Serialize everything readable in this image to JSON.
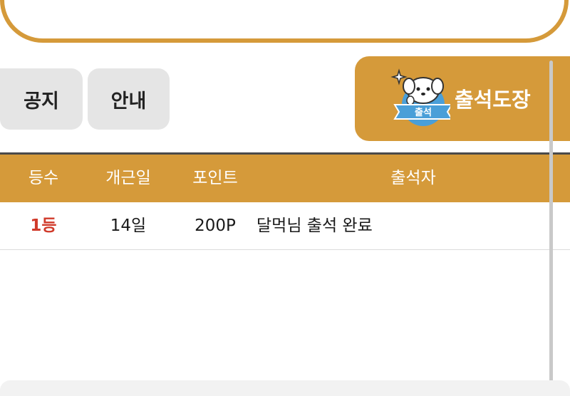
{
  "tabs": {
    "notice_label": "공지",
    "guide_label": "안내"
  },
  "attendance": {
    "button_label": "출석도장",
    "badge_text": "출석"
  },
  "table": {
    "headers": [
      "등수",
      "개근일",
      "포인트",
      "출석자"
    ],
    "rows": [
      {
        "rank": "1등",
        "days": "14일",
        "points": "200P",
        "message": "달먹님 출석 완료"
      }
    ]
  },
  "colors": {
    "accent": "#d59a3a",
    "rank_highlight": "#d03a2a",
    "badge_blue": "#4a9fd8"
  },
  "icons": {
    "mascot": "dog-mascot-icon",
    "sparkle": "sparkle-icon"
  }
}
